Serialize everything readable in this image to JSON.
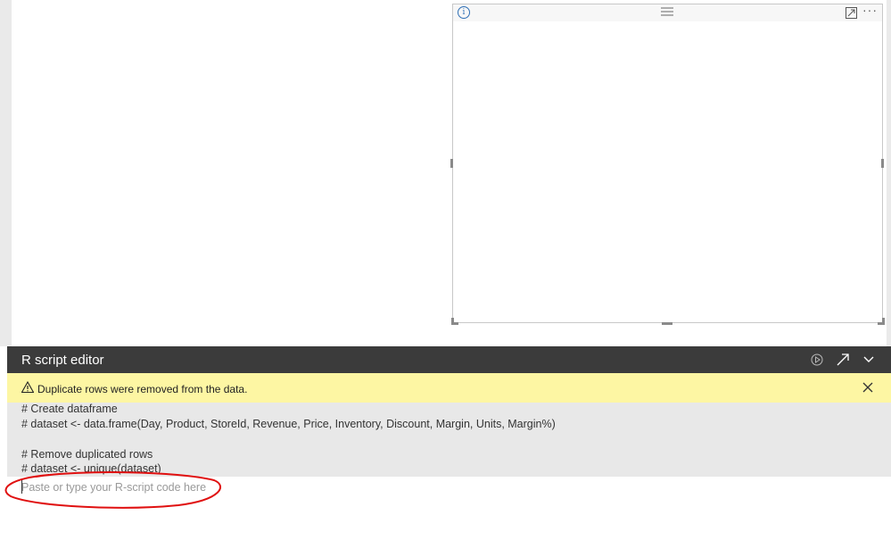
{
  "editor": {
    "title": "R script editor",
    "warning": "Duplicate rows were removed from the data.",
    "code_lines": [
      "# Create dataframe",
      "# dataset <- data.frame(Day, Product, StoreId, Revenue, Price, Inventory, Discount, Margin, Units, Margin%)",
      "",
      "# Remove duplicated rows",
      "# dataset <- unique(dataset)"
    ],
    "input_placeholder": "Paste or type your R-script code here"
  },
  "icons": {
    "info": "info-icon",
    "drag": "drag-handle-icon",
    "focus": "focus-mode-icon",
    "more": "more-options-icon",
    "run": "run-script-icon",
    "popout": "popout-icon",
    "collapse": "chevron-down-icon",
    "warning": "warning-icon",
    "close": "close-icon"
  },
  "colors": {
    "header_bg": "#3b3b3b",
    "warning_bg": "#fdf6a3",
    "code_bg": "#e8e8e8",
    "annotation": "#e01010"
  }
}
